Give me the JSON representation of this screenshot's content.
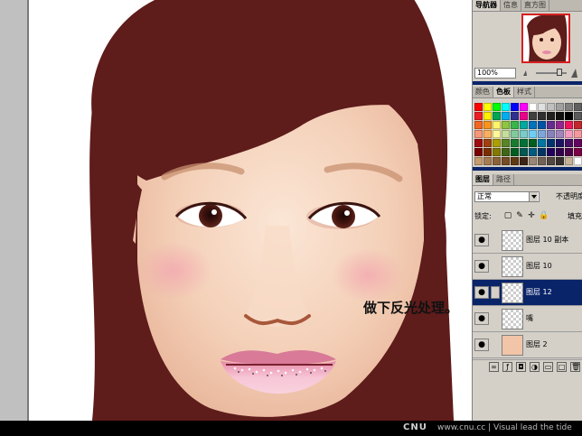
{
  "canvas": {
    "caption": "做下反光处理。"
  },
  "navigator": {
    "tabs": [
      "导航器",
      "信息",
      "直方图"
    ],
    "zoom_value": "100%"
  },
  "color_palette": {
    "tabs": [
      "颜色",
      "色板",
      "样式"
    ],
    "swatches": [
      "#ff0000",
      "#ffff00",
      "#00ff00",
      "#00ffff",
      "#0000ff",
      "#ff00ff",
      "#ffffff",
      "#e0e0e0",
      "#c0c0c0",
      "#a0a0a0",
      "#808080",
      "#606060",
      "#ee1c24",
      "#fff200",
      "#00a651",
      "#00aeef",
      "#2e3192",
      "#ec008c",
      "#404040",
      "#303030",
      "#202020",
      "#101010",
      "#000000",
      "#5a5a5a",
      "#f26522",
      "#f7941d",
      "#fff568",
      "#8dc63f",
      "#39b54a",
      "#00a99d",
      "#0072bc",
      "#0054a6",
      "#662d91",
      "#92278f",
      "#ed145b",
      "#c1272d",
      "#f69679",
      "#fbaf5d",
      "#fff799",
      "#c4df9b",
      "#82ca9c",
      "#7accc8",
      "#6dcff6",
      "#7da7d9",
      "#8781bd",
      "#a186be",
      "#f49ac1",
      "#f5989d",
      "#9e0b0f",
      "#a0410d",
      "#aba000",
      "#598527",
      "#197b30",
      "#007236",
      "#005e20",
      "#0076a3",
      "#003471",
      "#1b1464",
      "#440e62",
      "#630460",
      "#790000",
      "#7b2e00",
      "#827b00",
      "#406618",
      "#005e20",
      "#005952",
      "#005b7f",
      "#003663",
      "#21005d",
      "#32004b",
      "#4b0049",
      "#7b0046",
      "#c69c6d",
      "#a67c52",
      "#8c6239",
      "#754c24",
      "#603913",
      "#3c2415",
      "#998675",
      "#736357",
      "#534741",
      "#362f2d",
      "#c7b299",
      "#ffffff"
    ]
  },
  "layers_panel": {
    "tabs": [
      "图层",
      "路径"
    ],
    "blend_mode": "正常",
    "opacity_label": "不透明度",
    "lock_label": "锁定:",
    "fill_label": "填充",
    "layers": [
      {
        "name": "图层 10 副本",
        "selected": false,
        "thumb": "transparent"
      },
      {
        "name": "图层 10",
        "selected": false,
        "thumb": "transparent"
      },
      {
        "name": "图层 12",
        "selected": true,
        "thumb": "transparent"
      },
      {
        "name": "嘴",
        "selected": false,
        "thumb": "transparent"
      },
      {
        "name": "图层 2",
        "selected": false,
        "thumb": "face"
      }
    ]
  },
  "footer_bar": {
    "brand": "CNU",
    "tagline": "www.cnu.cc | Visual lead the tide"
  },
  "colors": {
    "hair": "#5e1c1b",
    "skin": "#f6d6c0",
    "lips": "#f0b0c4",
    "selection": "#0a246a",
    "palette_bg": "#d4d0c8"
  }
}
